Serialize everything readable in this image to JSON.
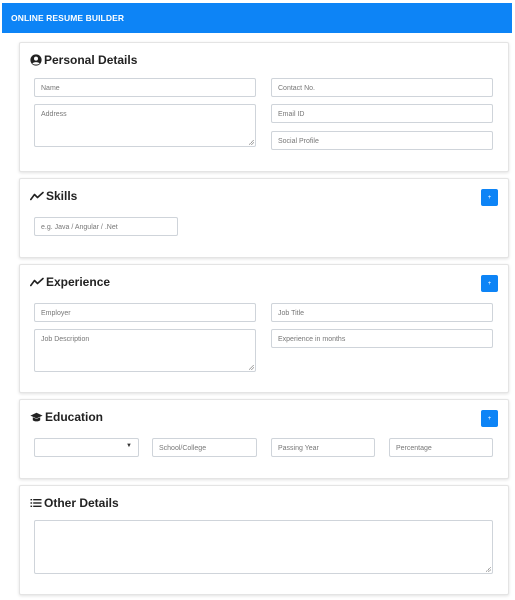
{
  "navbar": {
    "title": "ONLINE RESUME BUILDER"
  },
  "personal": {
    "title": "Personal Details",
    "name_placeholder": "Name",
    "contact_placeholder": "Contact No.",
    "address_placeholder": "Address",
    "email_placeholder": "Email ID",
    "social_placeholder": "Social Profile"
  },
  "skills": {
    "title": "Skills",
    "skill_placeholder": "e.g. Java / Angular / .Net",
    "add_label": "+"
  },
  "experience": {
    "title": "Experience",
    "employer_placeholder": "Employer",
    "job_title_placeholder": "Job Title",
    "job_desc_placeholder": "Job Description",
    "months_placeholder": "Experience in months",
    "add_label": "+"
  },
  "education": {
    "title": "Education",
    "select_value": "",
    "caret": "▼",
    "school_placeholder": "School/College",
    "year_placeholder": "Passing Year",
    "percentage_placeholder": "Percentage",
    "add_label": "+"
  },
  "other": {
    "title": "Other Details",
    "details_placeholder": ""
  }
}
